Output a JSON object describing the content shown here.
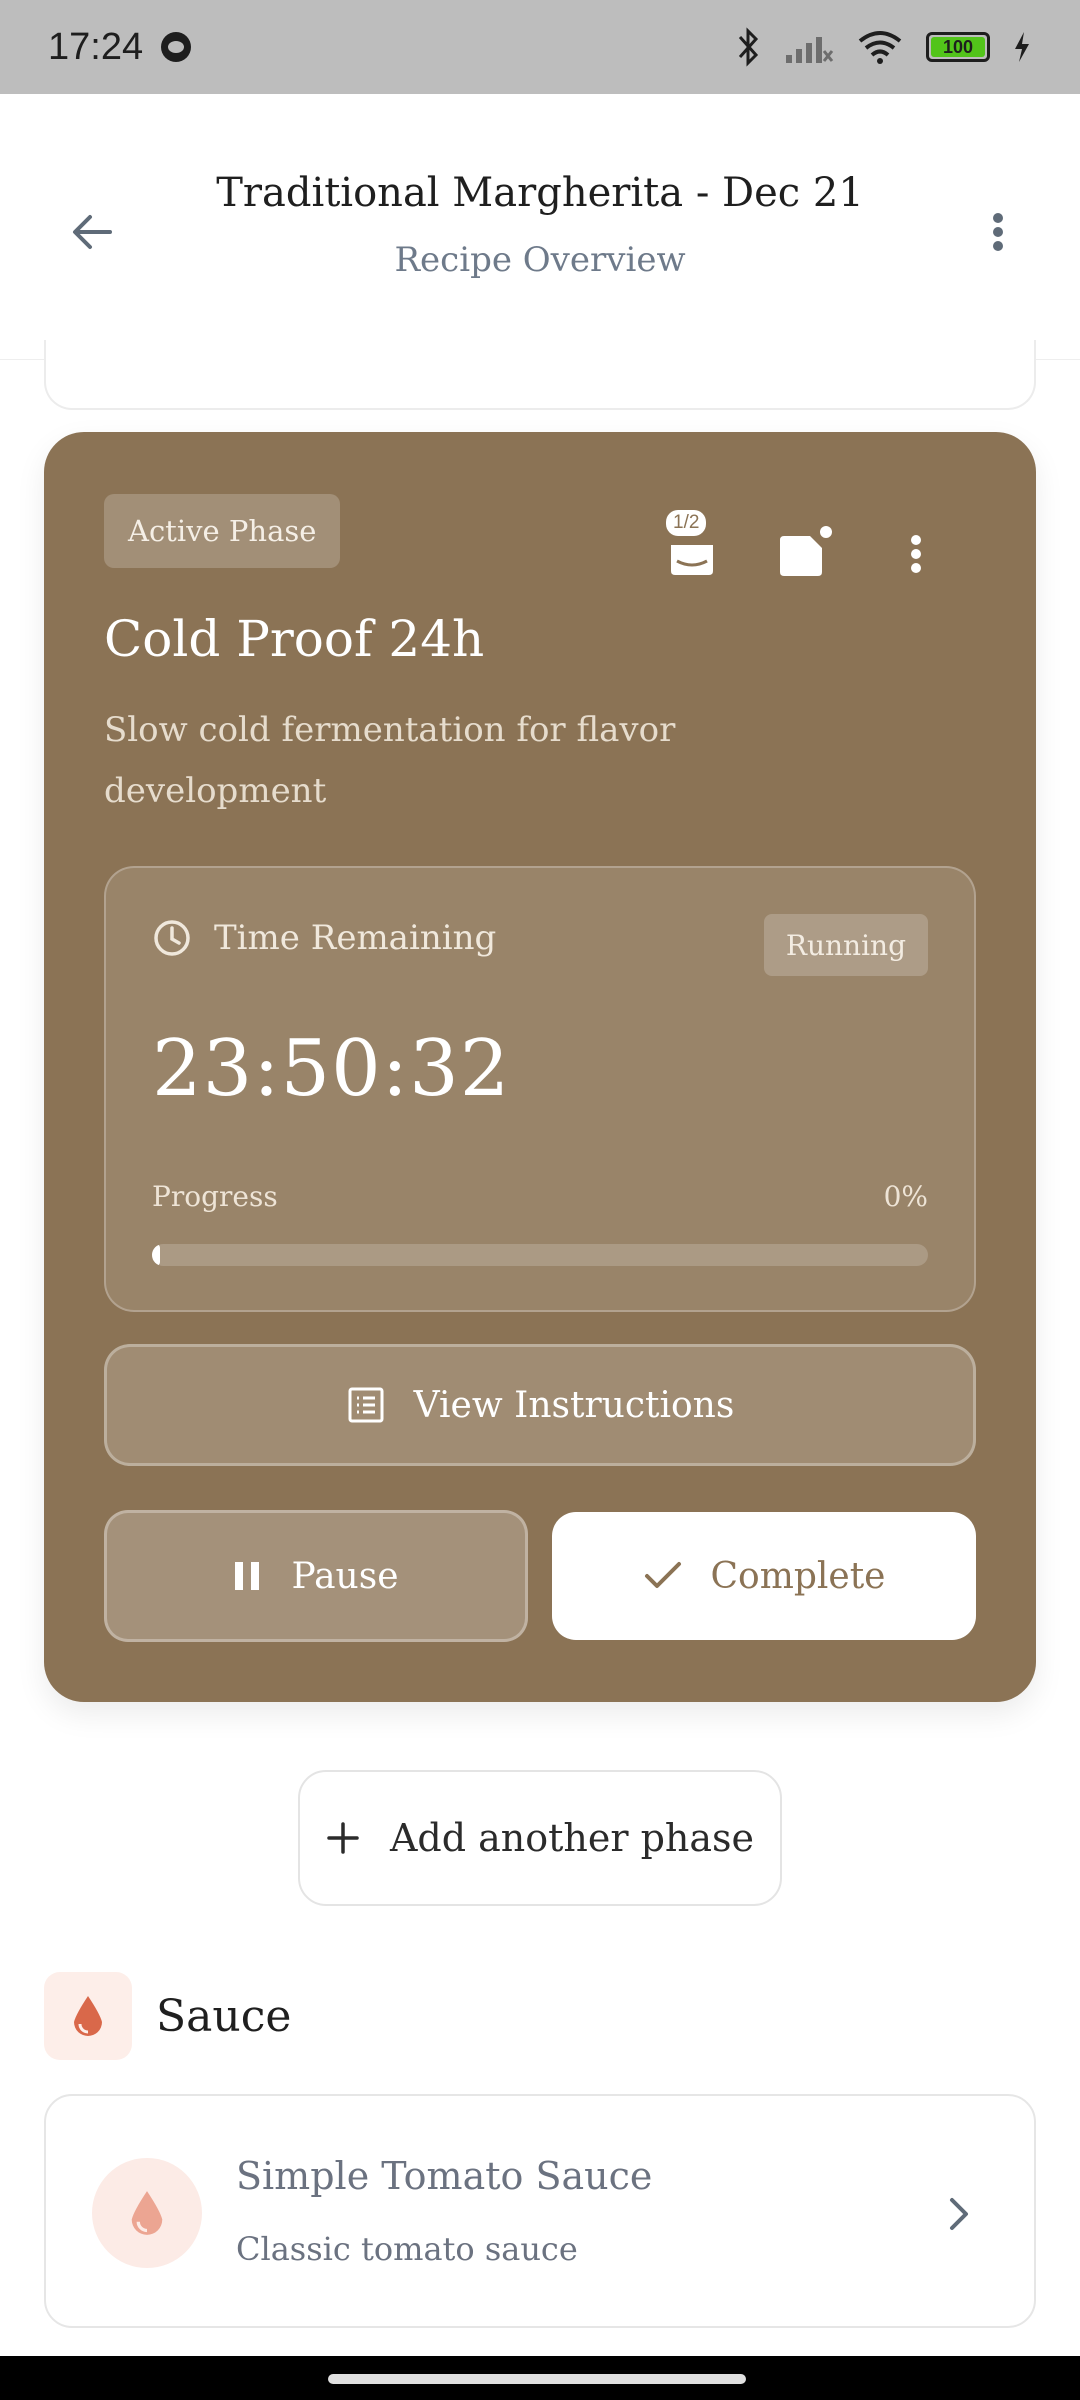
{
  "status": {
    "time": "17:24",
    "battery": "100"
  },
  "header": {
    "title": "Traditional Margherita - Dec 21",
    "subtitle": "Recipe Overview"
  },
  "phase": {
    "badge": "Active Phase",
    "photo_count": "1/2",
    "title": "Cold Proof 24h",
    "description": "Slow cold fermentation for flavor development",
    "timer": {
      "label": "Time Remaining",
      "status": "Running",
      "value": "23:50:32",
      "progress_label": "Progress",
      "progress_text": "0%",
      "progress_fraction": 0.01
    },
    "view_instructions": "View Instructions",
    "pause": "Pause",
    "complete": "Complete"
  },
  "add_phase": "Add another phase",
  "sauce_section": {
    "title": "Sauce",
    "item": {
      "name": "Simple Tomato Sauce",
      "description": "Classic tomato sauce"
    }
  },
  "colors": {
    "card": "#8b7355",
    "sauce_accent": "#d9684a"
  }
}
